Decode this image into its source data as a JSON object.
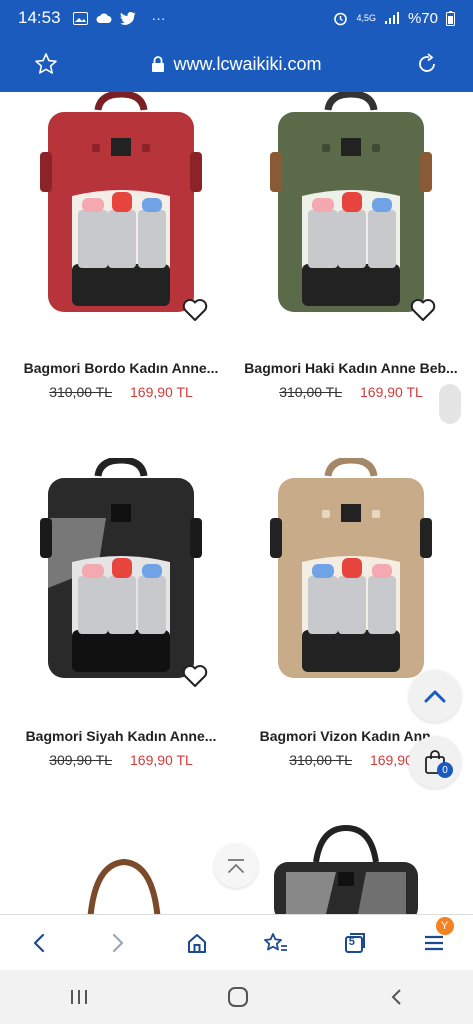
{
  "status": {
    "time": "14:53",
    "notification_icons": [
      "image-icon",
      "cloud-icon",
      "twitter-icon"
    ],
    "more": "···",
    "network": "4,5G",
    "battery": "%70"
  },
  "browser": {
    "url": "www.lcwaikiki.com"
  },
  "products": [
    {
      "name": "Bagmori Bordo Kadın Anne...",
      "old_price": "310,00 TL",
      "new_price": "169,90 TL",
      "color": "#b6343a"
    },
    {
      "name": "Bagmori Haki Kadın Anne Beb...",
      "old_price": "310,00 TL",
      "new_price": "169,90 TL",
      "color": "#5b6b4a"
    },
    {
      "name": "Bagmori Siyah Kadın Anne...",
      "old_price": "309,90 TL",
      "new_price": "169,90 TL",
      "color": "#2a2a2a"
    },
    {
      "name": "Bagmori Vizon Kadın Ann...",
      "old_price": "310,00 TL",
      "new_price": "169,90",
      "color": "#c8ac8a"
    }
  ],
  "cart": {
    "count": "0"
  },
  "nav": {
    "tabs_count": "5",
    "menu_badge": "Y"
  },
  "colors": {
    "brand_blue": "#1b5bbd",
    "price_red": "#d23a3a",
    "badge_orange": "#f58220"
  }
}
